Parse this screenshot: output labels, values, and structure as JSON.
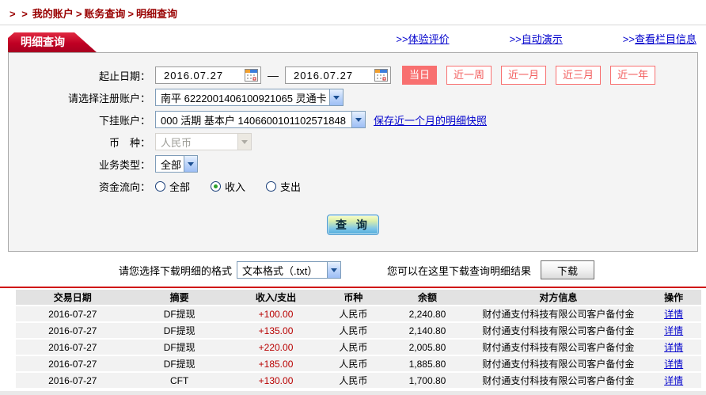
{
  "breadcrumb": {
    "prefix": "> >",
    "separator": ">",
    "items": [
      "我的账户",
      "账务查询",
      "明细查询"
    ]
  },
  "header_links": [
    {
      "arrow": ">>",
      "label": "体验评价"
    },
    {
      "arrow": ">>",
      "label": "自动演示"
    },
    {
      "arrow": ">>",
      "label": "查看栏目信息"
    }
  ],
  "tab": {
    "label": "明细查询"
  },
  "form": {
    "date_label": "起止日期：",
    "date_from": "2016.07.27",
    "date_to": "2016.07.27",
    "date_separator": "—",
    "range_buttons": [
      {
        "label": "当日",
        "active": true
      },
      {
        "label": "近一周",
        "active": false
      },
      {
        "label": "近一月",
        "active": false
      },
      {
        "label": "近三月",
        "active": false
      },
      {
        "label": "近一年",
        "active": false
      }
    ],
    "reg_account_label": "请选择注册账户：",
    "reg_account_value": "南平 6222001406100921065 灵通卡",
    "sub_account_label": "下挂账户：",
    "sub_account_value": "000 活期 基本户 1406600101102571848",
    "snapshot_link": "保存近一个月的明细快照",
    "currency_label": "币　种：",
    "currency_value": "人民币",
    "biz_type_label": "业务类型：",
    "biz_type_value": "全部",
    "flow_label": "资金流向：",
    "flow_options": [
      {
        "label": "全部",
        "checked": false
      },
      {
        "label": "收入",
        "checked": true
      },
      {
        "label": "支出",
        "checked": false
      }
    ],
    "query_button": "查 询"
  },
  "download": {
    "format_label": "请您选择下载明细的格式",
    "format_value": "文本格式（.txt）",
    "hint": "您可以在这里下载查询明细结果",
    "button_label": "下载"
  },
  "table": {
    "headers": [
      "交易日期",
      "摘要",
      "收入/支出",
      "币种",
      "余额",
      "对方信息",
      "操作"
    ],
    "rows": [
      {
        "date": "2016-07-27",
        "summary": "DF提现",
        "amount": "+100.00",
        "currency": "人民币",
        "balance": "2,240.80",
        "counterparty": "财付通支付科技有限公司客户备付金",
        "action": "详情"
      },
      {
        "date": "2016-07-27",
        "summary": "DF提现",
        "amount": "+135.00",
        "currency": "人民币",
        "balance": "2,140.80",
        "counterparty": "财付通支付科技有限公司客户备付金",
        "action": "详情"
      },
      {
        "date": "2016-07-27",
        "summary": "DF提现",
        "amount": "+220.00",
        "currency": "人民币",
        "balance": "2,005.80",
        "counterparty": "财付通支付科技有限公司客户备付金",
        "action": "详情"
      },
      {
        "date": "2016-07-27",
        "summary": "DF提现",
        "amount": "+185.00",
        "currency": "人民币",
        "balance": "1,885.80",
        "counterparty": "财付通支付科技有限公司客户备付金",
        "action": "详情"
      },
      {
        "date": "2016-07-27",
        "summary": "CFT",
        "amount": "+130.00",
        "currency": "人民币",
        "balance": "1,700.80",
        "counterparty": "财付通支付科技有限公司客户备付金",
        "action": "详情"
      }
    ]
  },
  "colors": {
    "brand_red": "#c00023",
    "breadcrumb_red": "#990000",
    "link_blue": "#0000cc",
    "range_salmon": "#f87070",
    "amount_red": "#b80000",
    "table_header_gray": "#e2e2e2",
    "row_gray": "#f2f2f2"
  }
}
